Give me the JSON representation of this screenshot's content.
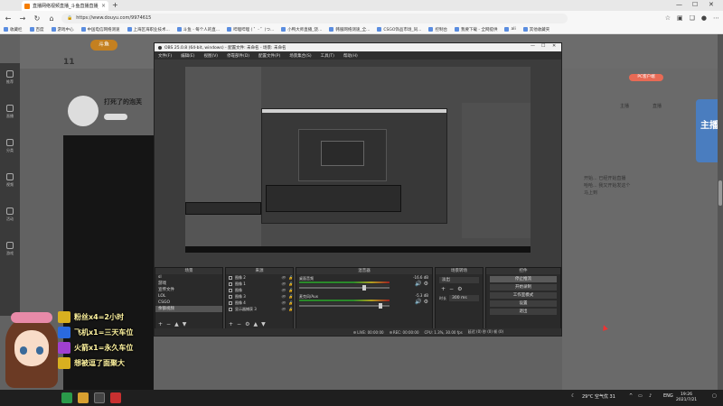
{
  "browser": {
    "tab_title": "直播网络视频直播_斗鱼直播直播_...",
    "url": "https://www.douyu.com/9974615",
    "bookmarks": [
      "收藏栏",
      "百度",
      "游戏中心",
      "中国电信网络测速",
      "上海区海职业技术...",
      "斗鱼 - 每个人的直...",
      "哔哩哔哩 ( ゜- ゜)つ...",
      "小鸭大师直播_饶...",
      "韩服网络测速_全...",
      "CSGO饰品市场_同...",
      "控制台",
      "我要下载 - 全网提供",
      "ali",
      "其他收藏夹"
    ]
  },
  "page": {
    "logo": "斗鱼",
    "follow_count": "11",
    "streamer_name": "打死了的泡芙",
    "sidebar_items": [
      "推荐",
      "直播",
      "分类",
      "视频",
      "活动",
      "游戏"
    ],
    "pc_button": "PC客户端",
    "right_texts": [
      "主播",
      "直播",
      "开始... 已经开始直播",
      "哈哈... 我又开始发这个",
      "马上到"
    ],
    "side_banner": "主播"
  },
  "obs": {
    "title": "OBS 25.0.8 (64-bit, windows) - 配置文件: 未命名 - 场景: 未命名",
    "menu": [
      "文件(F)",
      "编辑(E)",
      "视图(V)",
      "停靠部件(D)",
      "配置文件(P)",
      "场景集合(S)",
      "工具(T)",
      "帮助(H)"
    ],
    "panels": {
      "scenes": {
        "title": "场景",
        "items": [
          "sl",
          "游戏",
          "宣传文件",
          "LOL",
          "CSGO",
          "余额视频"
        ],
        "selected": 5
      },
      "sources": {
        "title": "来源",
        "items": [
          "图像 2",
          "图像 1",
          "图像",
          "图像 3",
          "图像 4",
          "显示器捕获 3"
        ]
      },
      "mixer": {
        "title": "混音器",
        "channels": [
          {
            "name": "桌面音频",
            "db": "-16.6 dB",
            "level": 0.7
          },
          {
            "name": "麦克风/Aux",
            "db": "-5.3 dB",
            "level": 0.88
          }
        ]
      },
      "transitions": {
        "title": "场景转场",
        "selected": "淡出",
        "duration_label": "时长",
        "duration": "300 ms"
      },
      "controls": {
        "title": "控件",
        "buttons": [
          "停止推流",
          "开始录制",
          "工作室模式",
          "设置",
          "退出"
        ],
        "active": 0
      }
    },
    "status": {
      "live": "LIVE: 00:00:00",
      "rec": "REC: 00:00:00",
      "cpu": "CPU: 1.3%, 30.00 fps",
      "extra": "延迟 (0) 秒 (0) 帧 (0)"
    }
  },
  "overlay": {
    "gifts": [
      {
        "text": "粉丝x4=2小时",
        "color": "#d8b020"
      },
      {
        "text": "飞机x1=三天车位",
        "color": "#2a6adf"
      },
      {
        "text": "火箭x1=永久车位",
        "color": "#a040d0"
      },
      {
        "text": "想被逗了面聚大",
        "color": "#d8b020"
      }
    ]
  },
  "taskbar": {
    "weather": "29°C 空气优 31",
    "lang": "ENG",
    "time": "19:26",
    "date": "2021/7/21"
  }
}
